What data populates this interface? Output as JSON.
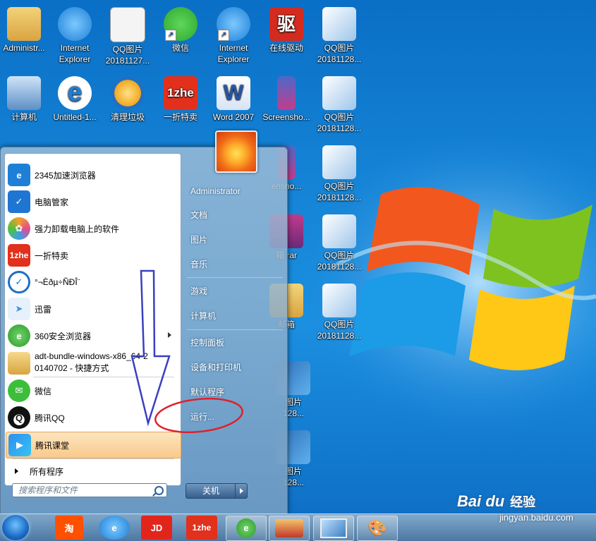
{
  "desktop": {
    "icons": [
      {
        "label": "Administr...",
        "sub": "",
        "color": "#d9a441"
      },
      {
        "label": "Internet",
        "sub": "Explorer",
        "color": "#1e7fd6"
      },
      {
        "label": "QQ图片",
        "sub": "20181127...",
        "color": "#eaeaea"
      },
      {
        "label": "微信",
        "sub": "",
        "color": "#3dbe3b"
      },
      {
        "label": "Internet",
        "sub": "Explorer",
        "color": "#1e7fd6"
      },
      {
        "label": "在线驱动",
        "sub": "",
        "color": "#d32b1f",
        "glyph": "驱"
      },
      {
        "label": "QQ图片",
        "sub": "20181128...",
        "color": "#dfe8f2"
      },
      {
        "label": "计算机",
        "sub": "",
        "color": "#7aa8d6"
      },
      {
        "label": "Untitled-1...",
        "sub": "",
        "color": "#1e7fd6",
        "glyph": "e"
      },
      {
        "label": "清理垃圾",
        "sub": "",
        "color": "#f2a81e"
      },
      {
        "label": "一折特卖",
        "sub": "",
        "color": "#e1301c",
        "glyph": "1zhe"
      },
      {
        "label": "Word 2007",
        "sub": "",
        "color": "#2556a8",
        "glyph": "W"
      },
      {
        "label": "Screensho...",
        "sub": "",
        "color": "#4d68c9"
      },
      {
        "label": "QQ图片",
        "sub": "20181128...",
        "color": "#dfe8f2"
      },
      {
        "label": "QQ图片",
        "sub": "20181128...",
        "color": "#dfe8f2"
      },
      {
        "label": "QQ图片",
        "sub": "20181128...",
        "color": "#dfe8f2"
      },
      {
        "label": "QQ图片",
        "sub": "20181128...",
        "color": "#dfe8f2"
      },
      {
        "label": "QQ图片",
        "sub": "20181128...",
        "color": "#dfe8f2"
      }
    ],
    "partial": {
      "screensho": "enshо...",
      "rar": "箱.rar",
      "xiang": "邮箱",
      "img1": "图片",
      "img1sub": "128...",
      "img2": "图片",
      "img2sub": "128..."
    }
  },
  "start_menu": {
    "programs": [
      {
        "label": "2345加速浏览器",
        "icon": "ie-blue-icon",
        "color": "#1e7fd6",
        "glyph": "e"
      },
      {
        "label": "电脑管家",
        "icon": "shield-icon",
        "color": "#1f76d2",
        "glyph": "✓"
      },
      {
        "label": "强力卸载电脑上的软件",
        "icon": "flower-icon",
        "color": "#f0a02a",
        "glyph": "✿"
      },
      {
        "label": "一折特卖",
        "icon": "1zhe-icon",
        "color": "#e1301c",
        "glyph": "1zhe"
      },
      {
        "label": "°¬Èðµ÷ÑÐÎ¨",
        "icon": "check-circle-icon",
        "color": "#1f6fc4",
        "glyph": "✓"
      },
      {
        "label": "迅雷",
        "icon": "bird-icon",
        "color": "#3f8fe0",
        "glyph": "➤"
      },
      {
        "label": "360安全浏览器",
        "icon": "360-browser-icon",
        "color": "#3aaa35",
        "glyph": "e"
      },
      {
        "label": "adt-bundle-windows-x86_64-2",
        "label2": "0140702 - 快捷方式",
        "icon": "folder-icon",
        "color": "#e7b94a",
        "glyph": ""
      },
      {
        "label": "微信",
        "icon": "wechat-icon",
        "color": "#3dbe3b",
        "glyph": "✉"
      },
      {
        "label": "腾讯QQ",
        "icon": "penguin-icon",
        "color": "#111111",
        "glyph": "Q"
      },
      {
        "label": "腾讯课堂",
        "icon": "tencent-class-icon",
        "color": "#2f8ff0",
        "glyph": "▶"
      }
    ],
    "all_programs": "所有程序",
    "search_placeholder": "搜索程序和文件",
    "right_items": [
      {
        "label": "Administrator"
      },
      {
        "label": "文档"
      },
      {
        "label": "图片"
      },
      {
        "label": "音乐"
      },
      {
        "label": "游戏"
      },
      {
        "label": "计算机"
      },
      {
        "label": "控制面板"
      },
      {
        "label": "设备和打印机"
      },
      {
        "label": "默认程序"
      },
      {
        "label": "运行..."
      }
    ],
    "shutdown": "关机"
  },
  "taskbar": {
    "items": [
      {
        "name": "taobao",
        "glyph": "淘",
        "color": "#ff5000"
      },
      {
        "name": "ie",
        "glyph": "e",
        "color": "#1e7fd6"
      },
      {
        "name": "jd",
        "glyph": "JD",
        "color": "#e1251b"
      },
      {
        "name": "1zhe",
        "glyph": "1zhe",
        "color": "#e1301c"
      },
      {
        "name": "360",
        "glyph": "e",
        "color": "#3aaa35"
      },
      {
        "name": "game",
        "glyph": "",
        "color": "#c0392b"
      },
      {
        "name": "photo",
        "glyph": "",
        "color": "#6aa6d8"
      },
      {
        "name": "paint",
        "glyph": "🎨",
        "color": "#e6e6e6"
      }
    ]
  },
  "watermark": {
    "cn": "经验",
    "url": "jingyan.baidu.com",
    "brand": "Bai du"
  }
}
